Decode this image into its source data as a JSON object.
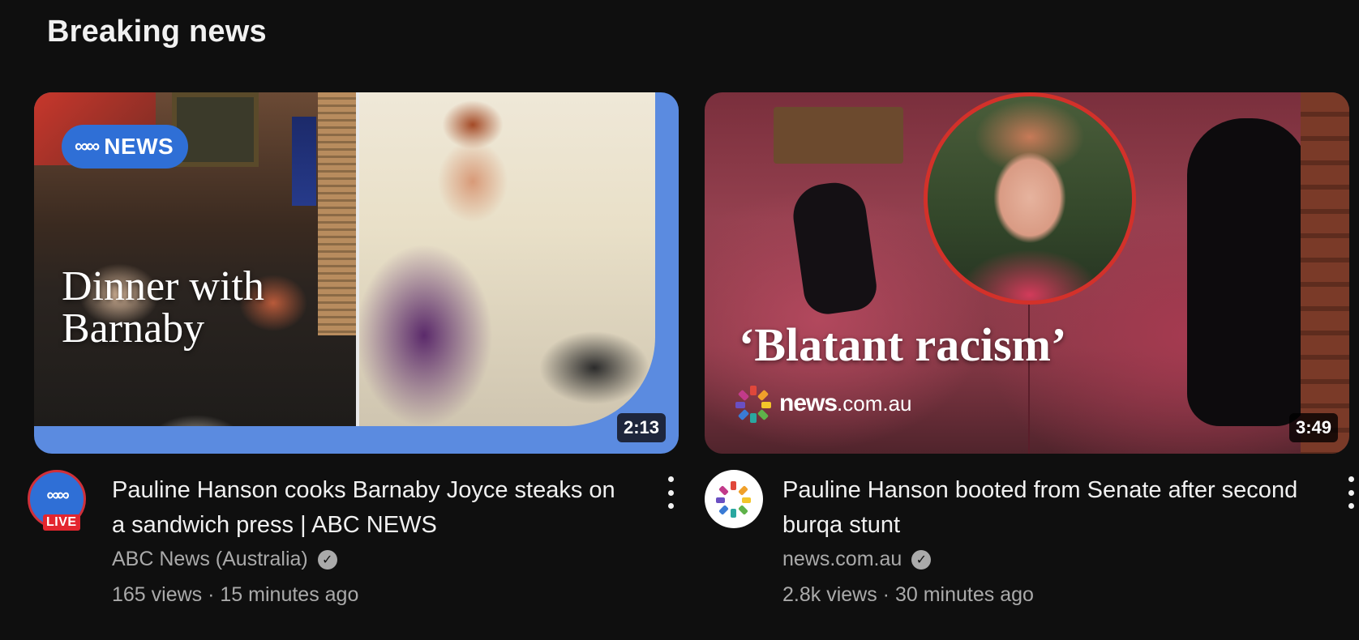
{
  "section": {
    "title": "Breaking news"
  },
  "videos": [
    {
      "thumbnail": {
        "badge_text": "NEWS",
        "badge_mark": "ABC",
        "overlay_line1": "Dinner with",
        "overlay_line2": "Barnaby",
        "duration": "2:13"
      },
      "title": "Pauline Hanson cooks Barnaby Joyce steaks on a sandwich press | ABC NEWS",
      "channel": "ABC News (Australia)",
      "verified": true,
      "views": "165 views",
      "age": "15 minutes ago",
      "avatar": {
        "logo": "ABC",
        "live_label": "LIVE"
      }
    },
    {
      "thumbnail": {
        "overlay_quote": "‘Blatant racism’",
        "brand_main": "news",
        "brand_domain": ".com.au",
        "duration": "3:49"
      },
      "title": "Pauline Hanson booted from Senate after second burqa stunt",
      "channel": "news.com.au",
      "verified": true,
      "views": "2.8k views",
      "age": "30 minutes ago"
    }
  ],
  "separator": "·",
  "colors": {
    "background": "#0f0f0f",
    "text_primary": "#f1f1f1",
    "text_secondary": "#aaaaaa",
    "abc_blue": "#2f6fd6",
    "live_red": "#e3262e"
  },
  "icons": {
    "verified": "check-circle-icon",
    "more": "vertical-ellipsis-icon"
  }
}
